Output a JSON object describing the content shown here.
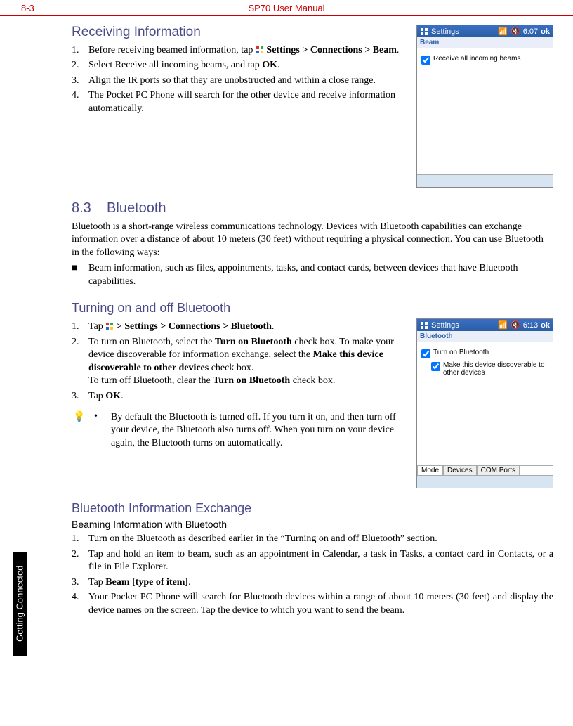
{
  "header": {
    "page": "8-3",
    "title": "SP70 User Manual"
  },
  "sideTab": "Getting Connected",
  "sec1": {
    "heading": "Receiving Information",
    "items": [
      {
        "n": "1.",
        "pre": "Before receiving beamed information, tap ",
        "bold": "Settings > Connections > Beam",
        "post": "."
      },
      {
        "n": "2.",
        "pre": "Select Receive all incoming beams, and tap ",
        "bold": "OK",
        "post": "."
      },
      {
        "n": "3.",
        "pre": "Align the IR ports so that they are unobstructed and within a close range.",
        "bold": "",
        "post": ""
      },
      {
        "n": "4.",
        "pre": "The Pocket PC Phone will search for the other device and receive information automatically.",
        "bold": "",
        "post": ""
      }
    ]
  },
  "shot1": {
    "title": "Settings",
    "time": "6:07",
    "ok": "ok",
    "sub": "Beam",
    "check": "Receive all incoming beams"
  },
  "sec2": {
    "num": "8.3",
    "title": "Bluetooth",
    "intro": "Bluetooth is a short-range wireless communications technology. Devices with Bluetooth capabilities can exchange information over a distance of about 10 meters (30 feet) without requiring a physical connection. You can use Bluetooth in the following ways:",
    "bullet": "Beam information, such as files, appointments, tasks, and contact cards, between devices that have Bluetooth capabilities."
  },
  "sec3": {
    "heading": "Turning on and off Bluetooth",
    "i1": {
      "n": "1.",
      "pre": "Tap ",
      "bold": "> Settings > Connections > Bluetooth",
      "post": "."
    },
    "i2": {
      "n": "2.",
      "a1": "To turn on Bluetooth, select the ",
      "b1": "Turn on Bluetooth",
      "a2": " check box. To make your device discoverable for information exchange, select the ",
      "b2": "Make this device discoverable to other devices",
      "a3": " check box.",
      "a4": "To turn off Bluetooth, clear the ",
      "b3": "Turn on Bluetooth",
      "a5": " check box."
    },
    "i3": {
      "n": "3.",
      "pre": "Tap ",
      "bold": "OK",
      "post": "."
    },
    "note": "By default the Bluetooth is turned off. If you turn it on, and then turn off your device, the Bluetooth also turns off. When you turn on your device again, the Bluetooth turns on automatically."
  },
  "shot2": {
    "title": "Settings",
    "time": "6:13",
    "ok": "ok",
    "sub": "Bluetooth",
    "check1": "Turn on Bluetooth",
    "check2": "Make this device discoverable to other devices",
    "tabs": [
      "Mode",
      "Devices",
      "COM Ports"
    ]
  },
  "sec4": {
    "heading": "Bluetooth Information Exchange",
    "sub": "Beaming Information with Bluetooth",
    "items": [
      {
        "n": "1.",
        "pre": "Turn on the Bluetooth as described earlier in the “Turning on and off Bluetooth” section.",
        "bold": "",
        "post": ""
      },
      {
        "n": "2.",
        "pre": "Tap and hold an item to beam, such as an appointment in Calendar, a task in Tasks, a contact card in Contacts, or a file in File Explorer.",
        "bold": "",
        "post": ""
      },
      {
        "n": "3.",
        "pre": "Tap ",
        "bold": "Beam [type of item]",
        "post": "."
      },
      {
        "n": "4.",
        "pre": "Your Pocket PC Phone will search for Bluetooth devices within a range of about 10 meters (30 feet) and display the device names on the screen. Tap the device to which you want to send the beam.",
        "bold": "",
        "post": ""
      }
    ]
  }
}
